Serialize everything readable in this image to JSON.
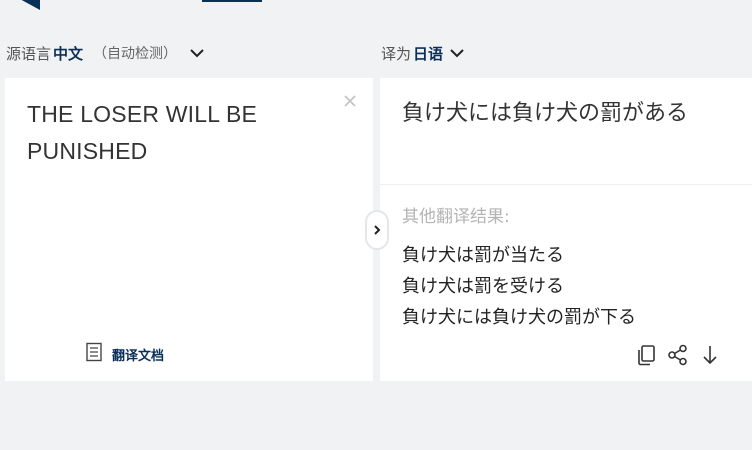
{
  "source_lang_bar": {
    "prefix": "源语言",
    "language": "中文",
    "auto_detect": "（自动检测）",
    "chevron_icon": "chevron-down-icon"
  },
  "target_lang_bar": {
    "prefix": "译为",
    "language": "日语",
    "chevron_icon": "chevron-down-icon"
  },
  "source_panel": {
    "text": "THE LOSER WILL BE PUNISHED",
    "clear_icon": "close-icon",
    "document_button_label": "翻译文档",
    "document_icon": "document-icon"
  },
  "swap_icon": "chevron-right-icon",
  "result_panel": {
    "main_result": "負け犬には負け犬の罰がある",
    "alternatives_heading": "其他翻译结果:",
    "alternatives": [
      "負け犬は罰が当たる",
      "負け犬は罰を受ける",
      "負け犬には負け犬の罰が下る"
    ],
    "action_icons": [
      "copy-icon",
      "share-icon",
      "download-icon"
    ]
  },
  "colors": {
    "brand": "#0b3058",
    "background": "#f1f2f4",
    "panel": "#ffffff",
    "muted_text": "#b4b4b4"
  }
}
